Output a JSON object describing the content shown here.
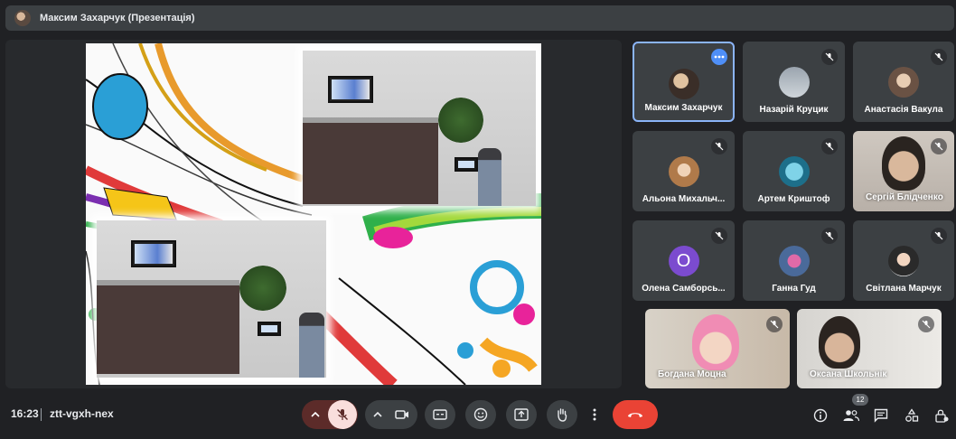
{
  "header": {
    "presenter_title": "Максим Захарчук (Презентація)"
  },
  "participants": [
    {
      "name": "Максим Захарчук",
      "avatar": "photo"
    },
    {
      "name": "Назарій Круцик",
      "avatar": "photo"
    },
    {
      "name": "Анастасія Вакула",
      "avatar": "photo"
    },
    {
      "name": "Альона Михальч...",
      "avatar": "photo"
    },
    {
      "name": "Артем Криштоф",
      "avatar": "photo"
    },
    {
      "name": "Сергій Блідченко",
      "avatar": "video"
    },
    {
      "name": "Олена Самборсь...",
      "avatar": "letter",
      "letter": "О",
      "letter_color": "#7b4bcf"
    },
    {
      "name": "Ганна Гуд",
      "avatar": "photo"
    },
    {
      "name": "Світлана Марчук",
      "avatar": "photo"
    },
    {
      "name": "Богдана Моцна",
      "avatar": "video"
    },
    {
      "name": "Оксана Школьнік",
      "avatar": "video"
    }
  ],
  "footer": {
    "time": "16:23",
    "meeting_code": "ztt-vgxh-nex",
    "participant_count": "12"
  },
  "icons": {
    "mic": "mic-off-icon",
    "camera": "videocam-icon",
    "captions": "closed-caption-icon",
    "emoji": "emoji-icon",
    "present": "present-screen-icon",
    "hand": "raise-hand-icon",
    "more": "more-vert-icon",
    "end_call": "call-end-icon",
    "info": "info-icon",
    "people": "people-icon",
    "chat": "chat-icon",
    "activities": "activities-icon",
    "lock": "host-controls-icon"
  },
  "colors": {
    "end_call": "#ea4335",
    "mic_off_bg": "#f9dedc",
    "active_border": "#8ab4f8"
  }
}
